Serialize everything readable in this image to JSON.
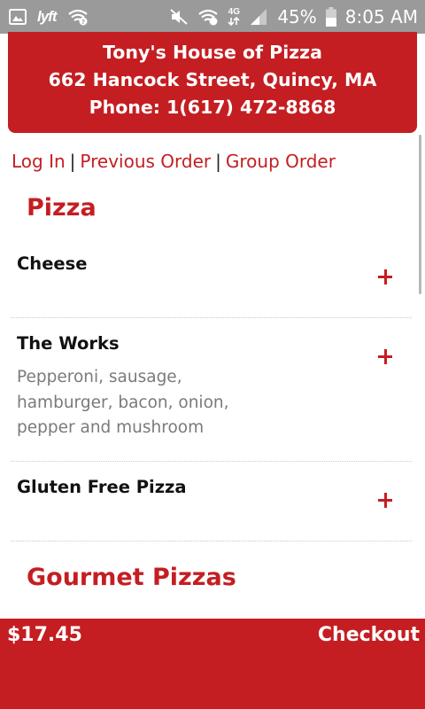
{
  "status_bar": {
    "battery_percent": "45%",
    "time": "8:05 AM",
    "icons": [
      "image-icon",
      "lyft-icon",
      "wifi-question-icon",
      "mute-icon",
      "wifi-calling-icon",
      "4g-lte-icon",
      "signal-icon",
      "battery-icon"
    ],
    "lyft_label": "lyft",
    "network_label": "4G"
  },
  "restaurant": {
    "name": "Tony's House of Pizza",
    "address": "662 Hancock Street, Quincy, MA",
    "phone": "Phone: 1(617) 472-8868"
  },
  "links": {
    "login": "Log In",
    "previous_order": "Previous Order",
    "group_order": "Group Order",
    "separator": "|"
  },
  "sections": [
    {
      "title": "Pizza",
      "items": [
        {
          "name": "Cheese",
          "description": ""
        },
        {
          "name": "The Works",
          "description": "Pepperoni, sausage, hamburger, bacon, onion, pepper and mushroom"
        },
        {
          "name": "Gluten Free Pizza",
          "description": ""
        }
      ]
    },
    {
      "title": "Gourmet Pizzas",
      "items": []
    }
  ],
  "cart": {
    "total": "$17.45",
    "checkout_label": "Checkout"
  },
  "colors": {
    "brand_red": "#c41e22",
    "status_bar": "#9a9a9a"
  }
}
